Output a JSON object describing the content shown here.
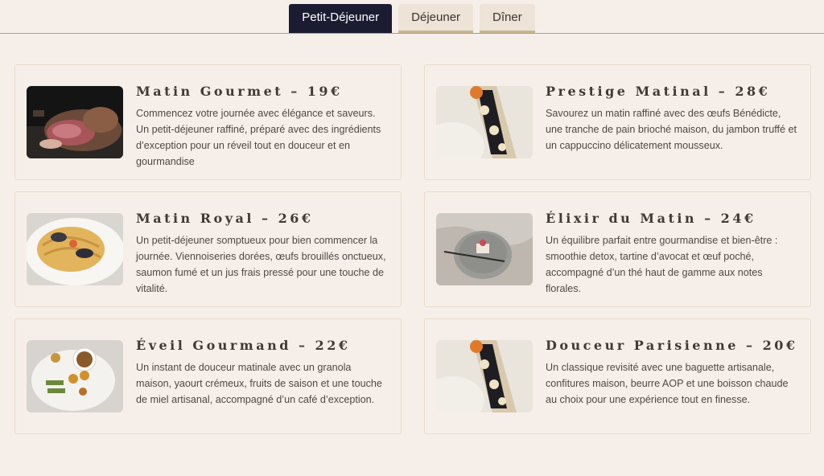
{
  "tabs": [
    {
      "label": "Petit-Déjeuner",
      "active": true
    },
    {
      "label": "Déjeuner",
      "active": false
    },
    {
      "label": "Dîner",
      "active": false
    }
  ],
  "menu": [
    {
      "title": "Matin Gourmet – 19€",
      "description": "Commencez votre journée avec élégance et saveurs. Un petit-déjeuner raffiné, préparé avec des ingrédients d’exception pour un réveil tout en douceur et en gourmandise",
      "image": "grilled-meat-photo"
    },
    {
      "title": "Prestige Matinal – 28€",
      "description": "Savourez un matin raffiné avec des œufs Bénédicte, une tranche de pain brioché maison, du jambon truffé et un cappuccino délicatement mousseux.",
      "image": "caviar-dish-photo"
    },
    {
      "title": "Matin Royal – 26€",
      "description": "Un petit-déjeuner somptueux pour bien commencer la journée. Viennoiseries dorées, œufs brouillés onctueux, saumon fumé et un jus frais pressé pour une touche de vitalité.",
      "image": "seafood-pasta-photo"
    },
    {
      "title": "Élixir du Matin – 24€",
      "description": "Un équilibre parfait entre gourmandise et bien-être : smoothie detox, tartine d’avocat et œuf poché, accompagné d’un thé haut de gamme aux notes florales.",
      "image": "dessert-plate-photo"
    },
    {
      "title": "Éveil Gourmand – 22€",
      "description": "Un instant de douceur matinale avec un granola maison, yaourt crémeux, fruits de saison et une touche de miel artisanal, accompagné d’un café d’exception.",
      "image": "coffee-snacks-photo"
    },
    {
      "title": "Douceur Parisienne – 20€",
      "description": "Un classique revisité avec une baguette artisanale, confitures maison, beurre AOP et une boisson chaude au choix pour une expérience tout en finesse.",
      "image": "caviar-dish-photo"
    }
  ],
  "colors": {
    "background": "#f6efe9",
    "active_tab": "#1b1b32",
    "inactive_tab": "#ede3d7",
    "tab_accent": "#c8b68f",
    "card_border": "#eadccd"
  }
}
